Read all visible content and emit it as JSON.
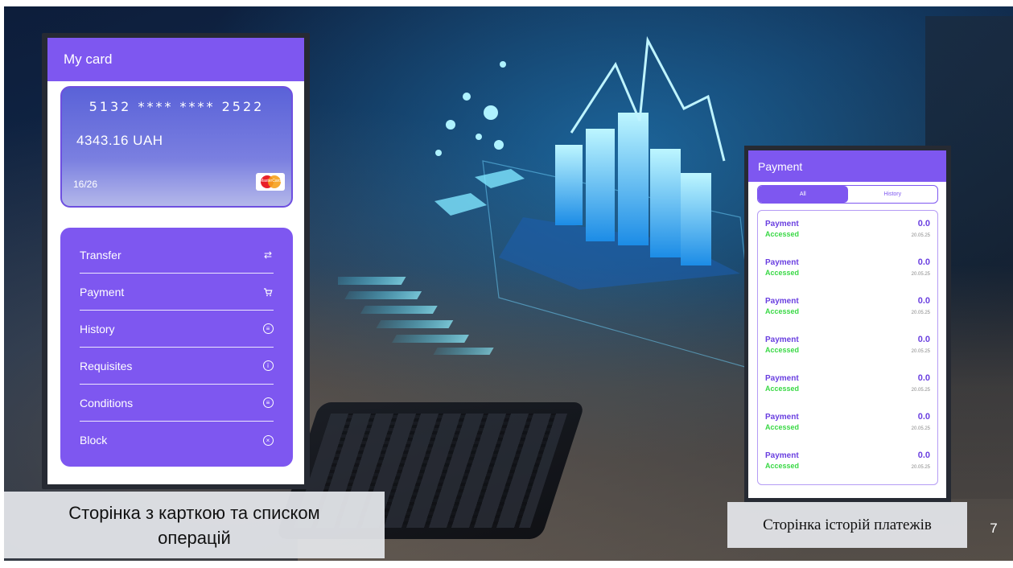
{
  "left_phone": {
    "title": "My card",
    "card": {
      "number": "5132 **** **** 2522",
      "balance": "4343.16 UAH",
      "expiry": "16/26",
      "brand_text": "MasterCard"
    },
    "menu": [
      {
        "label": "Transfer",
        "icon": "swap-arrows-icon"
      },
      {
        "label": "Payment",
        "icon": "cart-icon"
      },
      {
        "label": "History",
        "icon": "document-icon"
      },
      {
        "label": "Requisites",
        "icon": "info-icon"
      },
      {
        "label": "Conditions",
        "icon": "document-icon"
      },
      {
        "label": "Block",
        "icon": "close-circle-icon"
      }
    ]
  },
  "right_phone": {
    "title": "Payment",
    "tabs": [
      "All",
      "History"
    ],
    "payments": [
      {
        "title": "Payment",
        "status": "Accessed",
        "amount": "0.0",
        "date": "20.05.25"
      },
      {
        "title": "Payment",
        "status": "Accessed",
        "amount": "0.0",
        "date": "20.05.25"
      },
      {
        "title": "Payment",
        "status": "Accessed",
        "amount": "0.0",
        "date": "20.05.25"
      },
      {
        "title": "Payment",
        "status": "Accessed",
        "amount": "0.0",
        "date": "20.05.25"
      },
      {
        "title": "Payment",
        "status": "Accessed",
        "amount": "0.0",
        "date": "20.05.25"
      },
      {
        "title": "Payment",
        "status": "Accessed",
        "amount": "0.0",
        "date": "20.05.25"
      },
      {
        "title": "Payment",
        "status": "Accessed",
        "amount": "0.0",
        "date": "20.05.25"
      }
    ]
  },
  "captions": {
    "left_line1": "Сторінка з карткою та списком",
    "left_line2": "операцій",
    "right": "Сторінка історій платежів"
  },
  "page_number": "7",
  "colors": {
    "accent": "#7e57f0",
    "status_green": "#39d845",
    "payment_purple": "#6a3fe0"
  }
}
